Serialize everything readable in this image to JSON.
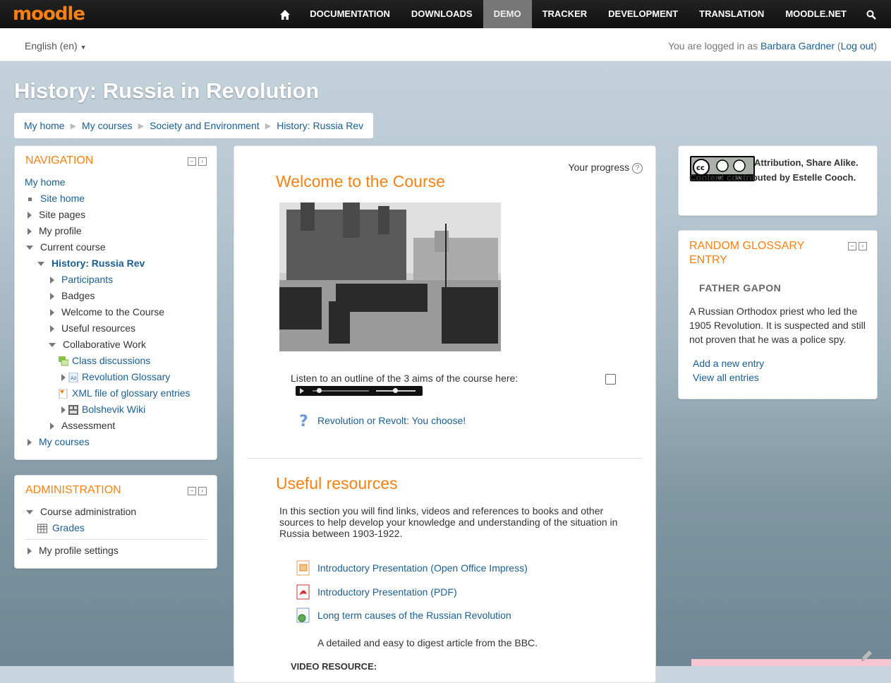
{
  "topbar": {
    "logo": "moodle",
    "items": [
      "DOCUMENTATION",
      "DOWNLOADS",
      "DEMO",
      "TRACKER",
      "DEVELOPMENT",
      "TRANSLATION",
      "MOODLE.NET"
    ],
    "active": "DEMO",
    "home_icon": "home-icon",
    "search_icon": "search-icon"
  },
  "subbar": {
    "language": "English (en)",
    "login_prefix": "You are logged in as",
    "user": "Barbara Gardner",
    "logout": "Log out"
  },
  "page_title": "History: Russia in Revolution",
  "breadcrumb": [
    "My home",
    "My courses",
    "Society and Environment",
    "History: Russia Rev"
  ],
  "navigation": {
    "title": "NAVIGATION",
    "my_home": "My home",
    "site_home": "Site home",
    "site_pages": "Site pages",
    "my_profile": "My profile",
    "current_course": "Current course",
    "course": "History: Russia Rev",
    "participants": "Participants",
    "badges": "Badges",
    "welcome": "Welcome to the Course",
    "useful": "Useful resources",
    "collab": "Collaborative Work",
    "class_disc": "Class discussions",
    "glossary": "Revolution Glossary",
    "xml": "XML file of glossary entries",
    "wiki": "Bolshevik Wiki",
    "assessment": "Assessment",
    "my_courses": "My courses"
  },
  "administration": {
    "title": "ADMINISTRATION",
    "course_admin": "Course administration",
    "grades": "Grades",
    "profile_settings": "My profile settings"
  },
  "main": {
    "progress": "Your progress",
    "welcome_title": "Welcome to the Course",
    "listen": "Listen to an outline of the 3 aims of the course here:",
    "quiz": "Revolution or Revolt: You choose!",
    "useful_title": "Useful resources",
    "useful_desc": "In this section you will find links, videos and references to books and other sources to help develop your knowledge and understanding of the situation in Russia between 1903-1922.",
    "res1": "Introductory Presentation (Open Office Impress)",
    "res2": "Introductory Presentation (PDF)",
    "res3": "Long term causes of the Russian Revolution",
    "res3_desc": "A detailed and easy to digest article from the BBC.",
    "video_heading": "VIDEO RESOURCE:"
  },
  "attribution": {
    "text": "Attribution, Share Alike. Content contributed by Estelle Cooch."
  },
  "glossary": {
    "title": "RANDOM GLOSSARY ENTRY",
    "term": "FATHER GAPON",
    "definition": "A Russian Orthodox priest who led the 1905 Revolution. It is suspected and still not proven that he was a police spy.",
    "add": "Add a new entry",
    "view": "View all entries"
  },
  "colors": {
    "accent": "#f98012",
    "link": "#1a5e92",
    "navbar": "#111111",
    "active_tab": "#777777"
  }
}
